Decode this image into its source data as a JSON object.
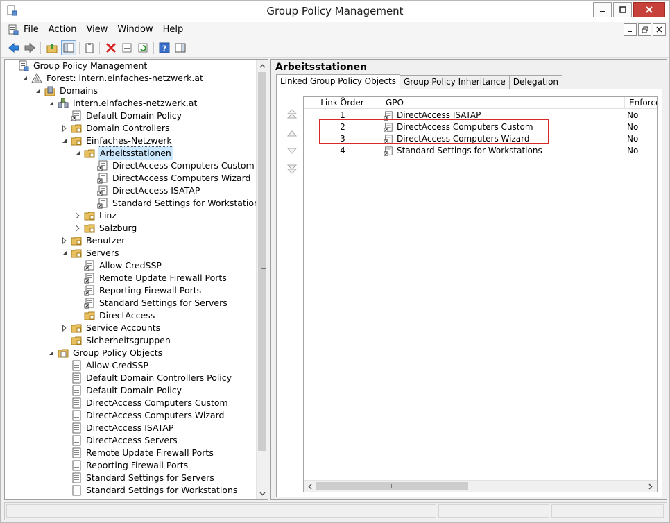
{
  "window": {
    "title": "Group Policy Management"
  },
  "menu": {
    "items": [
      "File",
      "Action",
      "View",
      "Window",
      "Help"
    ]
  },
  "colors": {
    "folder": "#e8c060",
    "highlight_box": "#d42a2a",
    "selection": "#cce8ff",
    "close_button": "#c7403a"
  },
  "tree": {
    "nodes": [
      {
        "label": "Group Policy Management",
        "icon": "gpm-icon",
        "expander": "none"
      },
      {
        "label": "Forest: intern.einfaches-netzwerk.at",
        "icon": "forest-icon",
        "expander": "expanded"
      },
      {
        "label": "Domains",
        "icon": "domains-icon",
        "expander": "expanded"
      },
      {
        "label": "intern.einfaches-netzwerk.at",
        "icon": "domain-icon",
        "expander": "expanded"
      },
      {
        "label": "Default Domain Policy",
        "icon": "gpo-link-icon",
        "expander": "none"
      },
      {
        "label": "Domain Controllers",
        "icon": "ou-folder-icon",
        "expander": "collapsed"
      },
      {
        "label": "Einfaches-Netzwerk",
        "icon": "ou-folder-icon",
        "expander": "expanded"
      },
      {
        "label": "Arbeitsstationen",
        "icon": "ou-folder-icon",
        "expander": "expanded",
        "selected": true
      },
      {
        "label": "DirectAccess Computers Custom",
        "icon": "gpo-link-icon",
        "expander": "none"
      },
      {
        "label": "DirectAccess Computers Wizard",
        "icon": "gpo-link-icon",
        "expander": "none"
      },
      {
        "label": "DirectAccess ISATAP",
        "icon": "gpo-link-icon",
        "expander": "none"
      },
      {
        "label": "Standard Settings for Workstations",
        "icon": "gpo-link-icon",
        "expander": "none"
      },
      {
        "label": "Linz",
        "icon": "ou-folder-icon",
        "expander": "collapsed"
      },
      {
        "label": "Salzburg",
        "icon": "ou-folder-icon",
        "expander": "collapsed"
      },
      {
        "label": "Benutzer",
        "icon": "ou-folder-icon",
        "expander": "collapsed"
      },
      {
        "label": "Servers",
        "icon": "ou-folder-icon",
        "expander": "expanded"
      },
      {
        "label": "Allow CredSSP",
        "icon": "gpo-link-icon",
        "expander": "none"
      },
      {
        "label": "Remote Update Firewall Ports",
        "icon": "gpo-link-icon",
        "expander": "none"
      },
      {
        "label": "Reporting Firewall Ports",
        "icon": "gpo-link-icon",
        "expander": "none"
      },
      {
        "label": "Standard Settings for Servers",
        "icon": "gpo-link-icon",
        "expander": "none"
      },
      {
        "label": "DirectAccess",
        "icon": "ou-folder-icon",
        "expander": "none"
      },
      {
        "label": "Service Accounts",
        "icon": "ou-folder-icon",
        "expander": "collapsed"
      },
      {
        "label": "Sicherheitsgruppen",
        "icon": "ou-folder-icon",
        "expander": "none"
      },
      {
        "label": "Group Policy Objects",
        "icon": "gpo-container-icon",
        "expander": "expanded"
      },
      {
        "label": "Allow CredSSP",
        "icon": "gpo-icon",
        "expander": "none"
      },
      {
        "label": "Default Domain Controllers Policy",
        "icon": "gpo-icon",
        "expander": "none"
      },
      {
        "label": "Default Domain Policy",
        "icon": "gpo-icon",
        "expander": "none"
      },
      {
        "label": "DirectAccess Computers Custom",
        "icon": "gpo-icon",
        "expander": "none"
      },
      {
        "label": "DirectAccess Computers Wizard",
        "icon": "gpo-icon",
        "expander": "none"
      },
      {
        "label": "DirectAccess ISATAP",
        "icon": "gpo-icon",
        "expander": "none"
      },
      {
        "label": "DirectAccess Servers",
        "icon": "gpo-icon",
        "expander": "none"
      },
      {
        "label": "Remote Update Firewall Ports",
        "icon": "gpo-icon",
        "expander": "none"
      },
      {
        "label": "Reporting Firewall Ports",
        "icon": "gpo-icon",
        "expander": "none"
      },
      {
        "label": "Standard Settings for Servers",
        "icon": "gpo-icon",
        "expander": "none"
      },
      {
        "label": "Standard Settings for Workstations",
        "icon": "gpo-icon",
        "expander": "none"
      }
    ]
  },
  "details": {
    "title": "Arbeitsstationen",
    "tabs": [
      "Linked Group Policy Objects",
      "Group Policy Inheritance",
      "Delegation"
    ],
    "active_tab": 0,
    "columns": [
      "Link Order",
      "GPO",
      "Enforced"
    ],
    "rows": [
      {
        "order": "1",
        "gpo": "DirectAccess ISATAP",
        "enforced": "No"
      },
      {
        "order": "2",
        "gpo": "DirectAccess Computers Custom",
        "enforced": "No"
      },
      {
        "order": "3",
        "gpo": "DirectAccess Computers Wizard",
        "enforced": "No"
      },
      {
        "order": "4",
        "gpo": "Standard Settings for Workstations",
        "enforced": "No"
      }
    ]
  }
}
